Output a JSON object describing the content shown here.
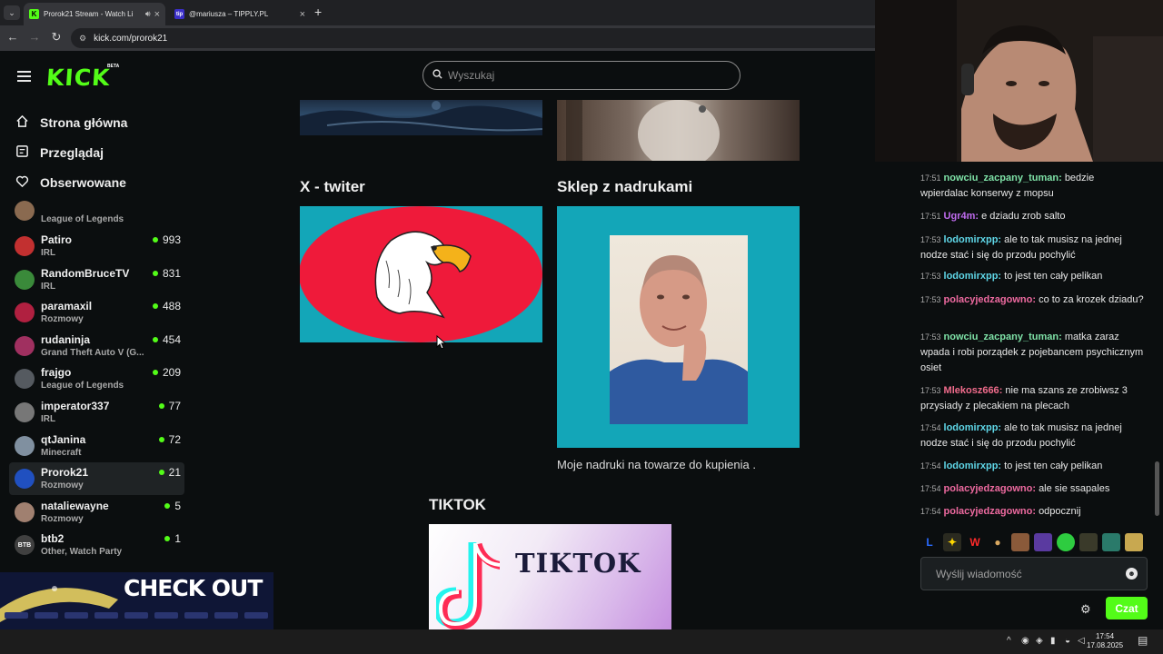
{
  "browser": {
    "tabs": [
      {
        "title": "Prorok21 Stream - Watch Li",
        "favicon": "K"
      },
      {
        "title": "@mariusza – TIPPLY.PL",
        "favicon": "tip"
      }
    ],
    "new_tab": "+",
    "url": "kick.com/prorok21"
  },
  "header": {
    "logo": "KICK",
    "beta": "BETA",
    "search_placeholder": "Wyszukaj"
  },
  "sidebar": {
    "nav": [
      {
        "label": "Strona główna",
        "icon": "home-icon"
      },
      {
        "label": "Przeglądaj",
        "icon": "browse-icon"
      },
      {
        "label": "Obserwowane",
        "icon": "heart-icon"
      }
    ],
    "partial_channel": {
      "category": "League of Legends"
    },
    "channels": [
      {
        "name": "Patiro",
        "category": "IRL",
        "viewers": "993",
        "avatar_color": "#c23030"
      },
      {
        "name": "RandomBruceTV",
        "category": "IRL",
        "viewers": "831",
        "avatar_color": "#3a8a3a"
      },
      {
        "name": "paramaxil",
        "category": "Rozmowy",
        "viewers": "488",
        "avatar_color": "#b02040"
      },
      {
        "name": "rudaninja",
        "category": "Grand Theft Auto V (G...",
        "viewers": "454",
        "avatar_color": "#a03060"
      },
      {
        "name": "frajgo",
        "category": "League of Legends",
        "viewers": "209",
        "avatar_color": "#555a60"
      },
      {
        "name": "imperator337",
        "category": "IRL",
        "viewers": "77",
        "avatar_color": "#777"
      },
      {
        "name": "qtJanina",
        "category": "Minecraft",
        "viewers": "72",
        "avatar_color": "#8090a0"
      },
      {
        "name": "Prorok21",
        "category": "Rozmowy",
        "viewers": "21",
        "avatar_color": "#2050c0"
      },
      {
        "name": "nataliewayne",
        "category": "Rozmowy",
        "viewers": "5",
        "avatar_color": "#a08070"
      },
      {
        "name": "btb2",
        "category": "Other, Watch Party",
        "viewers": "1",
        "avatar_color": "#404040",
        "avatar_text": "BTB"
      }
    ]
  },
  "main": {
    "sections": [
      {
        "title": "X - twiter"
      },
      {
        "title": "Sklep z nadrukami",
        "description": "Moje nadruki na towarze do kupienia ."
      },
      {
        "title": "TIKTOK",
        "image_text": "TIKTOK"
      }
    ]
  },
  "chat": {
    "messages": [
      {
        "time": "17:51",
        "user": "nowciu_zacpany_tuman",
        "color": "#7fe3a8",
        "text": "bedzie wpierdalac konserwy z mopsu"
      },
      {
        "time": "17:51",
        "user": "Ugr4m",
        "color": "#c16cf0",
        "text": "e dziadu zrob salto"
      },
      {
        "time": "17:53",
        "user": "lodomirxpp",
        "color": "#5fd7e8",
        "text": "ale to tak musisz na jednej nodze stać i się do przodu pochylić"
      },
      {
        "time": "17:53",
        "user": "lodomirxpp",
        "color": "#5fd7e8",
        "text": "to jest ten cały pelikan"
      },
      {
        "time": "17:53",
        "user": "polacyjedzagowno",
        "color": "#ee6aa0",
        "text": "co to za krozek dziadu?"
      },
      {
        "time": "17:53",
        "user": "nowciu_zacpany_tuman",
        "color": "#7fe3a8",
        "text": "matka zaraz wpada i robi porządek z pojebancem psychicznym osiet"
      },
      {
        "time": "17:53",
        "user": "Mlekosz666",
        "color": "#f06c8c",
        "text": "nie ma szans ze zrobiwsz 3 przysiady z plecakiem na plecach"
      },
      {
        "time": "17:54",
        "user": "lodomirxpp",
        "color": "#5fd7e8",
        "text": "ale to tak musisz na jednej nodze stać i się do przodu pochylić"
      },
      {
        "time": "17:54",
        "user": "lodomirxpp",
        "color": "#5fd7e8",
        "text": "to jest ten cały pelikan"
      },
      {
        "time": "17:54",
        "user": "polacyjedzagowno",
        "color": "#ee6aa0",
        "text": "ale sie ssapales"
      },
      {
        "time": "17:54",
        "user": "polacyjedzagowno",
        "color": "#ee6aa0",
        "text": "odpocznij"
      }
    ],
    "emotes": [
      "L",
      "W"
    ],
    "input_placeholder": "Wyślij wiadomość",
    "send_label": "Czat"
  },
  "ad": {
    "text": "CHECK OUT"
  },
  "taskbar": {
    "time": "17:54",
    "date": "17.08.2025"
  },
  "colors": {
    "accent": "#53fc18",
    "background": "#0b0e0f"
  }
}
